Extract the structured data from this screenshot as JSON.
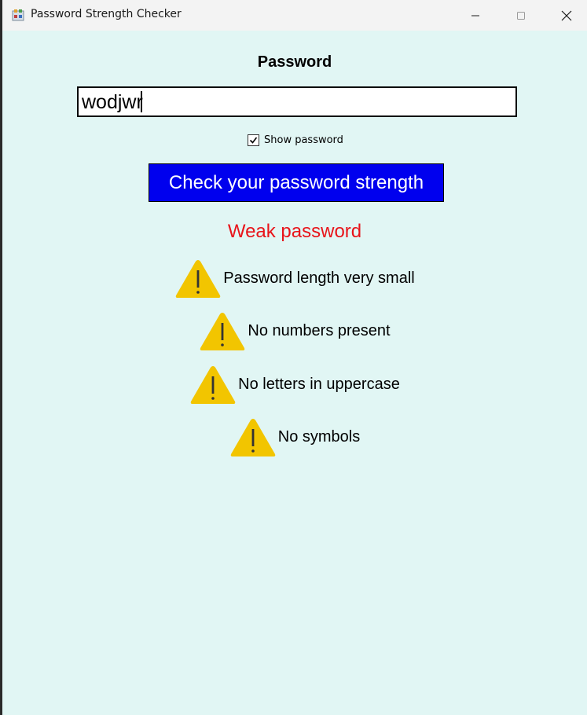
{
  "window": {
    "title": "Password Strength Checker"
  },
  "form": {
    "label": "Password",
    "password_value": "wodjwr",
    "show_password_label": "Show password",
    "show_password_checked": true,
    "check_button_label": "Check your password strength"
  },
  "result": {
    "text": "Weak password",
    "color": "#e8141a"
  },
  "warnings": [
    {
      "icon": "warning-icon",
      "text": "Password length very small"
    },
    {
      "icon": "warning-icon",
      "text": "No numbers present"
    },
    {
      "icon": "warning-icon",
      "text": "No letters in uppercase"
    },
    {
      "icon": "warning-icon",
      "text": "No symbols"
    }
  ],
  "colors": {
    "background": "#e1f6f4",
    "button": "#0000ee",
    "warning_icon": "#f2c500"
  }
}
